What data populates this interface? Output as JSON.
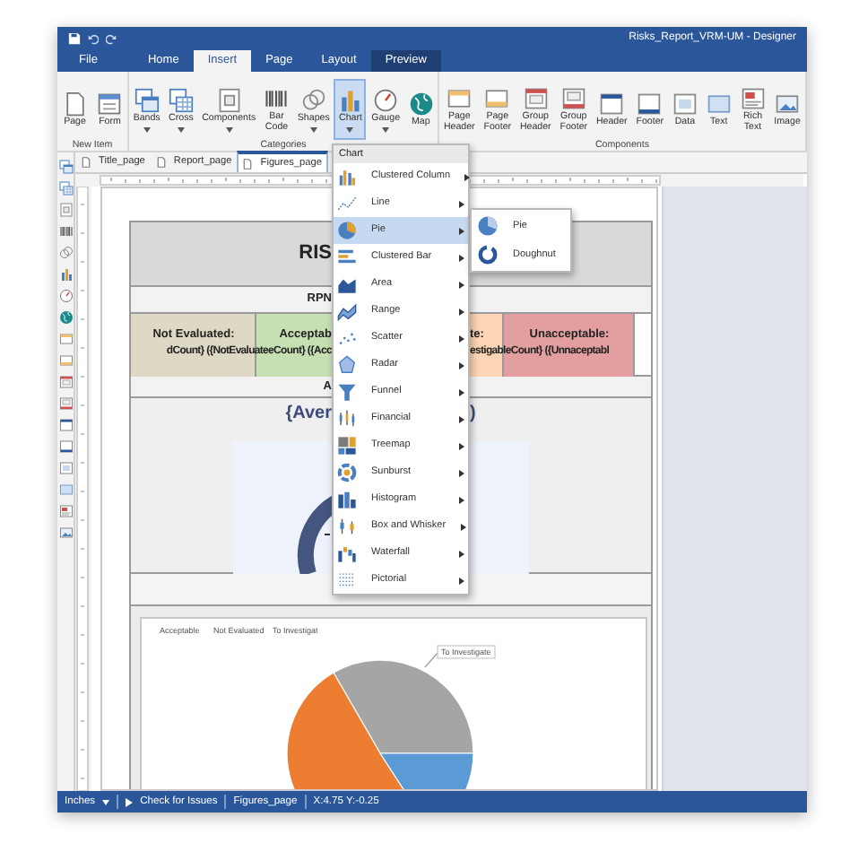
{
  "window": {
    "title": "Risks_Report_VRM-UM - Designer"
  },
  "ribbon_tabs": [
    {
      "label": "File",
      "selected": false,
      "kind": "tab"
    },
    {
      "label": "Home",
      "selected": false,
      "kind": "tab"
    },
    {
      "label": "Insert",
      "selected": true,
      "kind": "tab"
    },
    {
      "label": "Page",
      "selected": false,
      "kind": "tab"
    },
    {
      "label": "Layout",
      "selected": false,
      "kind": "tab"
    },
    {
      "label": "Preview",
      "selected": false,
      "kind": "preview"
    }
  ],
  "ribbon_groups": [
    {
      "label": "New Item",
      "items": [
        {
          "label": "Page",
          "dropdown": false,
          "selected": false
        },
        {
          "label": "Form",
          "dropdown": false,
          "selected": false
        }
      ]
    },
    {
      "label": "Categories",
      "items": [
        {
          "label": "Bands",
          "dropdown": true,
          "selected": false
        },
        {
          "label": "Cross",
          "dropdown": true,
          "selected": false
        },
        {
          "label": "Components",
          "dropdown": true,
          "selected": false
        },
        {
          "label": "Bar Code",
          "dropdown": false,
          "selected": false
        },
        {
          "label": "Shapes",
          "dropdown": true,
          "selected": false
        },
        {
          "label": "Chart",
          "dropdown": true,
          "selected": true
        },
        {
          "label": "Gauge",
          "dropdown": true,
          "selected": false
        },
        {
          "label": "Map",
          "dropdown": false,
          "selected": false
        }
      ]
    },
    {
      "label": "Components",
      "items": [
        {
          "label": "Page Header",
          "dropdown": false,
          "selected": false
        },
        {
          "label": "Page Footer",
          "dropdown": false,
          "selected": false
        },
        {
          "label": "Group Header",
          "dropdown": false,
          "selected": false
        },
        {
          "label": "Group Footer",
          "dropdown": false,
          "selected": false
        },
        {
          "label": "Header",
          "dropdown": false,
          "selected": false
        },
        {
          "label": "Footer",
          "dropdown": false,
          "selected": false
        },
        {
          "label": "Data",
          "dropdown": false,
          "selected": false
        },
        {
          "label": "Text",
          "dropdown": false,
          "selected": false
        },
        {
          "label": "Rich Text",
          "dropdown": false,
          "selected": false
        },
        {
          "label": "Image",
          "dropdown": false,
          "selected": false
        }
      ]
    }
  ],
  "page_tabs": [
    {
      "label": "Title_page",
      "selected": false
    },
    {
      "label": "Report_page",
      "selected": false
    },
    {
      "label": "Figures_page",
      "selected": true
    }
  ],
  "report": {
    "title": "RIS",
    "rpn": "RPN",
    "risk_levels": [
      {
        "label": "Not Evaluated:",
        "color": "#ddd9c4"
      },
      {
        "label": "Acceptab",
        "color": "#c6e0b4"
      },
      {
        "label": "te:",
        "color": "#fbd5b5"
      },
      {
        "label": "Unacceptable:",
        "color": "#e39f9f"
      }
    ],
    "count_lines": [
      "dCount} ({NotEvaluateeCount} ({Acc",
      "estigableCount} ({Unnaceptabl"
    ],
    "average_label": "A",
    "average_left": "{Aver",
    "average_right": ")",
    "chart": {
      "legend": [
        "Acceptable",
        "Not Evaluated",
        "To Investigat"
      ],
      "data_label": "To Investigate"
    }
  },
  "chart_menu": {
    "header": "Chart",
    "items": [
      {
        "label": "Clustered Column",
        "selected": false
      },
      {
        "label": "Line",
        "selected": false
      },
      {
        "label": "Pie",
        "selected": true
      },
      {
        "label": "Clustered Bar",
        "selected": false
      },
      {
        "label": "Area",
        "selected": false
      },
      {
        "label": "Range",
        "selected": false
      },
      {
        "label": "Scatter",
        "selected": false
      },
      {
        "label": "Radar",
        "selected": false
      },
      {
        "label": "Funnel",
        "selected": false
      },
      {
        "label": "Financial",
        "selected": false
      },
      {
        "label": "Treemap",
        "selected": false
      },
      {
        "label": "Sunburst",
        "selected": false
      },
      {
        "label": "Histogram",
        "selected": false
      },
      {
        "label": "Box and Whisker",
        "selected": false
      },
      {
        "label": "Waterfall",
        "selected": false
      },
      {
        "label": "Pictorial",
        "selected": false
      }
    ]
  },
  "pie_submenu": {
    "items": [
      {
        "label": "Pie"
      },
      {
        "label": "Doughnut"
      }
    ]
  },
  "status_bar": {
    "unit": "Inches",
    "action": "Check for Issues",
    "page": "Figures_page",
    "position": "X:4.75 Y:-0.25"
  }
}
